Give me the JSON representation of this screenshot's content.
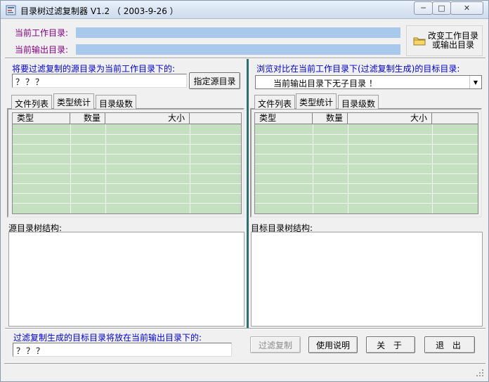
{
  "window": {
    "title": "目录树过滤复制器 V1.2 （ 2003-9-26 ）",
    "controls": {
      "minimize": "─",
      "maximize": "□",
      "close": "✕"
    }
  },
  "top": {
    "work_dir_label": "当前工作目录:",
    "work_dir_value": "",
    "out_dir_label": "当前输出目录:",
    "out_dir_value": "",
    "change_btn_line1": "改变工作目录",
    "change_btn_line2": "或输出目录"
  },
  "left": {
    "source_label": "将要过滤复制的源目录为当前工作目录下的:",
    "source_value": "？？？",
    "specify_btn": "指定源目录",
    "tabs": [
      "文件列表",
      "类型统计",
      "目录级数"
    ],
    "active_tab": 1,
    "columns": [
      "类型",
      "数量",
      "大小"
    ],
    "tree_label": "源目录树结构:"
  },
  "right": {
    "browse_label": "浏览对比在当前工作目录下(过滤复制生成)的目标目录:",
    "select_value": "当前输出目录下无子目录 ！",
    "tabs": [
      "文件列表",
      "类型统计",
      "目录级数"
    ],
    "active_tab": 1,
    "columns": [
      "类型",
      "数量",
      "大小"
    ],
    "tree_label": "目标目录树结构:"
  },
  "bottom": {
    "target_label": "过滤复制生成的目标目录将放在当前输出目录下的:",
    "target_value": "？？？",
    "filter_copy_btn": "过滤复制",
    "help_btn": "使用说明",
    "about_btn": "关 于",
    "exit_btn": "退 出"
  },
  "colors": {
    "label_purple": "#800080",
    "label_blue": "#0000c8",
    "path_bar": "#a8c8ec",
    "grid_green": "#c5e0c0",
    "separator": "#2f6f6f"
  }
}
